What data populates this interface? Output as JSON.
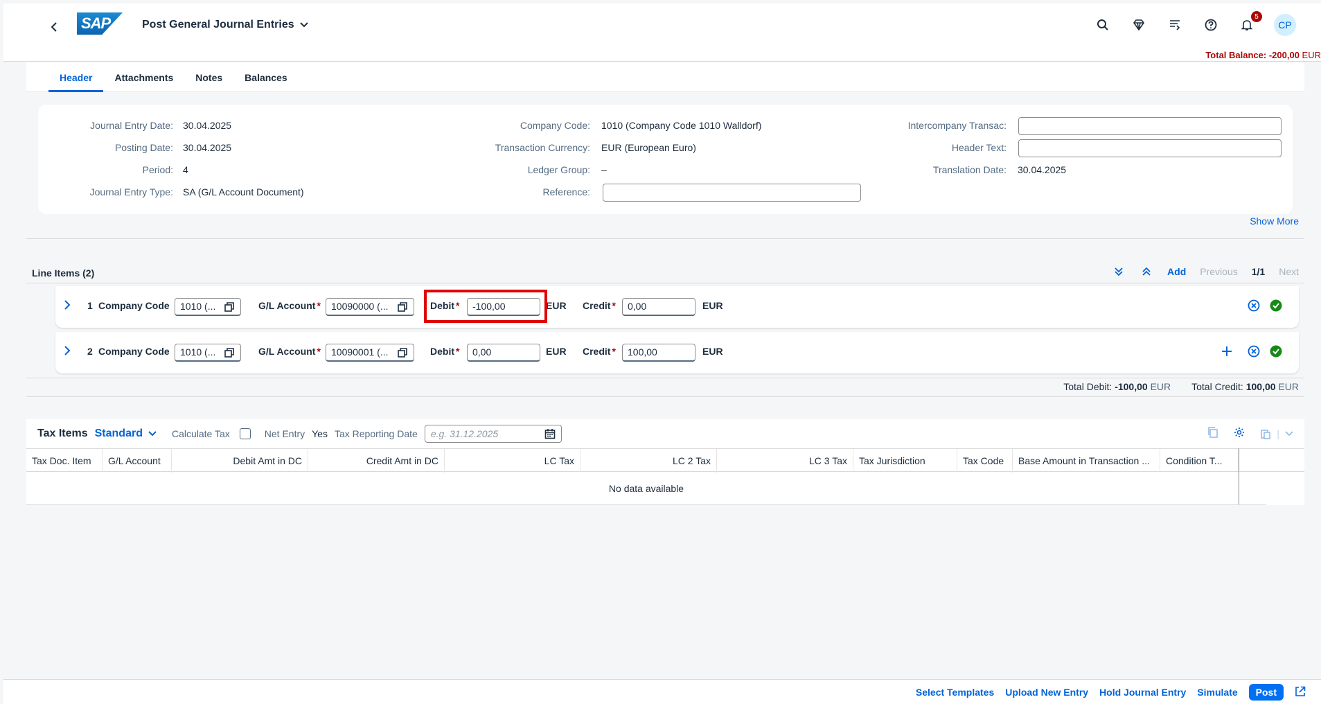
{
  "shell": {
    "app_title": "Post General Journal Entries",
    "logo_text": "SAP",
    "notification_count": "5",
    "avatar_initials": "CP",
    "total_balance_label": "Total Balance: -200,00",
    "total_balance_currency": "EUR"
  },
  "tabs": [
    "Header",
    "Attachments",
    "Notes",
    "Balances"
  ],
  "header": {
    "col1": [
      {
        "label": "Journal Entry Date:",
        "value": "30.04.2025"
      },
      {
        "label": "Posting Date:",
        "value": "30.04.2025"
      },
      {
        "label": "Period:",
        "value": "4"
      },
      {
        "label": "Journal Entry Type:",
        "value": "SA (G/L Account Document)"
      }
    ],
    "col2": [
      {
        "label": "Company Code:",
        "value": "1010 (Company Code 1010 Walldorf)"
      },
      {
        "label": "Transaction Currency:",
        "value": "EUR (European Euro)"
      },
      {
        "label": "Ledger Group:",
        "value": "–"
      },
      {
        "label": "Reference:",
        "value": ""
      }
    ],
    "col3": [
      {
        "label": "Intercompany Transac:",
        "value": ""
      },
      {
        "label": "Header Text:",
        "value": ""
      },
      {
        "label": "Translation Date:",
        "value": "30.04.2025"
      }
    ],
    "show_more": "Show More"
  },
  "line_items": {
    "title": "Line Items (2)",
    "add": "Add",
    "previous": "Previous",
    "page": "1/1",
    "next": "Next",
    "labels": {
      "company_code": "Company Code",
      "gl_account": "G/L Account",
      "debit": "Debit",
      "credit": "Credit",
      "currency": "EUR",
      "required": "*"
    },
    "rows": [
      {
        "num": "1",
        "company_code": "1010 (...",
        "gl_account": "10090000 (...",
        "debit": "-100,00",
        "credit": "0,00"
      },
      {
        "num": "2",
        "company_code": "1010 (...",
        "gl_account": "10090001 (...",
        "debit": "0,00",
        "credit": "100,00"
      }
    ],
    "total_debit_label": "Total Debit:",
    "total_debit_value": "-100,00",
    "total_credit_label": "Total Credit:",
    "total_credit_value": "100,00",
    "total_currency": "EUR"
  },
  "tax_items": {
    "title": "Tax Items",
    "variant": "Standard",
    "calculate_tax": "Calculate Tax",
    "net_entry": "Net Entry",
    "net_entry_value": "Yes",
    "reporting_date_label": "Tax Reporting Date",
    "reporting_date_placeholder": "e.g. 31.12.2025",
    "columns": [
      "Tax Doc. Item",
      "G/L Account",
      "Debit Amt in DC",
      "Credit Amt in DC",
      "LC Tax",
      "LC 2 Tax",
      "LC 3 Tax",
      "Tax Jurisdiction",
      "Tax Code",
      "Base Amount in Transaction ...",
      "Condition T..."
    ],
    "no_data": "No data available"
  },
  "footer": {
    "select_templates": "Select Templates",
    "upload_new_entry": "Upload New Entry",
    "hold_journal_entry": "Hold Journal Entry",
    "simulate": "Simulate",
    "post": "Post"
  },
  "colors": {
    "brand": "#0064d9",
    "negative": "#aa0808",
    "highlight": "#e20000",
    "success": "#188918"
  }
}
